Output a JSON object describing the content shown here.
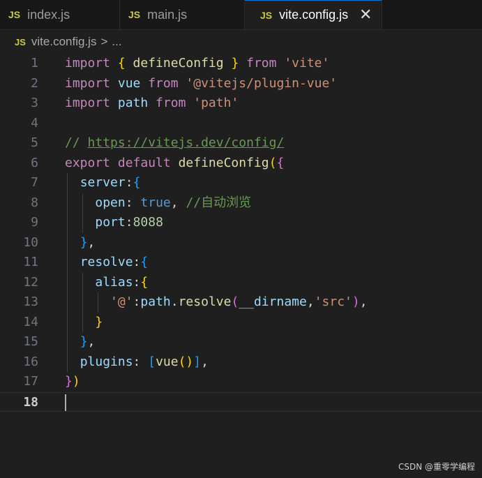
{
  "tabs": [
    {
      "icon": "JS",
      "label": "index.js"
    },
    {
      "icon": "JS",
      "label": "main.js"
    },
    {
      "icon": "JS",
      "label": "vite.config.js",
      "close": "✕"
    }
  ],
  "breadcrumb": {
    "icon": "JS",
    "file": "vite.config.js",
    "separator": ">",
    "more": "..."
  },
  "lines": [
    {
      "n": "1",
      "t": [
        [
          "kw",
          "import "
        ],
        [
          "b1",
          "{"
        ],
        [
          "pl",
          " "
        ],
        [
          "fn",
          "defineConfig"
        ],
        [
          "pl",
          " "
        ],
        [
          "b1",
          "}"
        ],
        [
          "kw",
          " from "
        ],
        [
          "str",
          "'vite'"
        ]
      ]
    },
    {
      "n": "2",
      "t": [
        [
          "kw",
          "import "
        ],
        [
          "var",
          "vue"
        ],
        [
          "kw",
          " from "
        ],
        [
          "str",
          "'@vitejs/plugin-vue'"
        ]
      ]
    },
    {
      "n": "3",
      "t": [
        [
          "kw",
          "import "
        ],
        [
          "var",
          "path"
        ],
        [
          "kw",
          " from "
        ],
        [
          "str",
          "'path'"
        ]
      ]
    },
    {
      "n": "4",
      "t": []
    },
    {
      "n": "5",
      "t": [
        [
          "cm",
          "// "
        ],
        [
          "cm link",
          "https://vitejs.dev/config/"
        ]
      ]
    },
    {
      "n": "6",
      "t": [
        [
          "kw",
          "export default "
        ],
        [
          "fn",
          "defineConfig"
        ],
        [
          "b1",
          "("
        ],
        [
          "b2",
          "{"
        ]
      ]
    },
    {
      "n": "7",
      "t": [
        [
          "pl",
          "  "
        ],
        [
          "var",
          "server"
        ],
        [
          "pl",
          ":"
        ],
        [
          "b3",
          "{"
        ]
      ]
    },
    {
      "n": "8",
      "t": [
        [
          "pl",
          "    "
        ],
        [
          "var",
          "open"
        ],
        [
          "pl",
          ": "
        ],
        [
          "kb",
          "true"
        ],
        [
          "pl",
          ", "
        ],
        [
          "cm",
          "//自动浏览"
        ]
      ]
    },
    {
      "n": "9",
      "t": [
        [
          "pl",
          "    "
        ],
        [
          "var",
          "port"
        ],
        [
          "pl",
          ":"
        ],
        [
          "num",
          "8088"
        ]
      ]
    },
    {
      "n": "10",
      "t": [
        [
          "pl",
          "  "
        ],
        [
          "b3",
          "}"
        ],
        [
          "pl",
          ","
        ]
      ]
    },
    {
      "n": "11",
      "t": [
        [
          "pl",
          "  "
        ],
        [
          "var",
          "resolve"
        ],
        [
          "pl",
          ":"
        ],
        [
          "b3",
          "{"
        ]
      ]
    },
    {
      "n": "12",
      "t": [
        [
          "pl",
          "    "
        ],
        [
          "var",
          "alias"
        ],
        [
          "pl",
          ":"
        ],
        [
          "b1",
          "{"
        ]
      ]
    },
    {
      "n": "13",
      "t": [
        [
          "pl",
          "      "
        ],
        [
          "str",
          "'@'"
        ],
        [
          "pl",
          ":"
        ],
        [
          "var",
          "path"
        ],
        [
          "pl",
          "."
        ],
        [
          "fn",
          "resolve"
        ],
        [
          "b2",
          "("
        ],
        [
          "var",
          "__dirname"
        ],
        [
          "pl",
          ","
        ],
        [
          "str",
          "'src'"
        ],
        [
          "b2",
          ")"
        ],
        [
          "pl",
          ","
        ]
      ]
    },
    {
      "n": "14",
      "t": [
        [
          "pl",
          "    "
        ],
        [
          "b1",
          "}"
        ]
      ]
    },
    {
      "n": "15",
      "t": [
        [
          "pl",
          "  "
        ],
        [
          "b3",
          "}"
        ],
        [
          "pl",
          ","
        ]
      ]
    },
    {
      "n": "16",
      "t": [
        [
          "pl",
          "  "
        ],
        [
          "var",
          "plugins"
        ],
        [
          "pl",
          ": "
        ],
        [
          "b3",
          "["
        ],
        [
          "fn",
          "vue"
        ],
        [
          "b1",
          "()"
        ],
        [
          "b3",
          "]"
        ],
        [
          "pl",
          ","
        ]
      ]
    },
    {
      "n": "17",
      "t": [
        [
          "b2",
          "}"
        ],
        [
          "b1",
          ")"
        ]
      ]
    },
    {
      "n": "18",
      "t": [],
      "current": true
    }
  ],
  "watermark": "CSDN @重零学编程"
}
